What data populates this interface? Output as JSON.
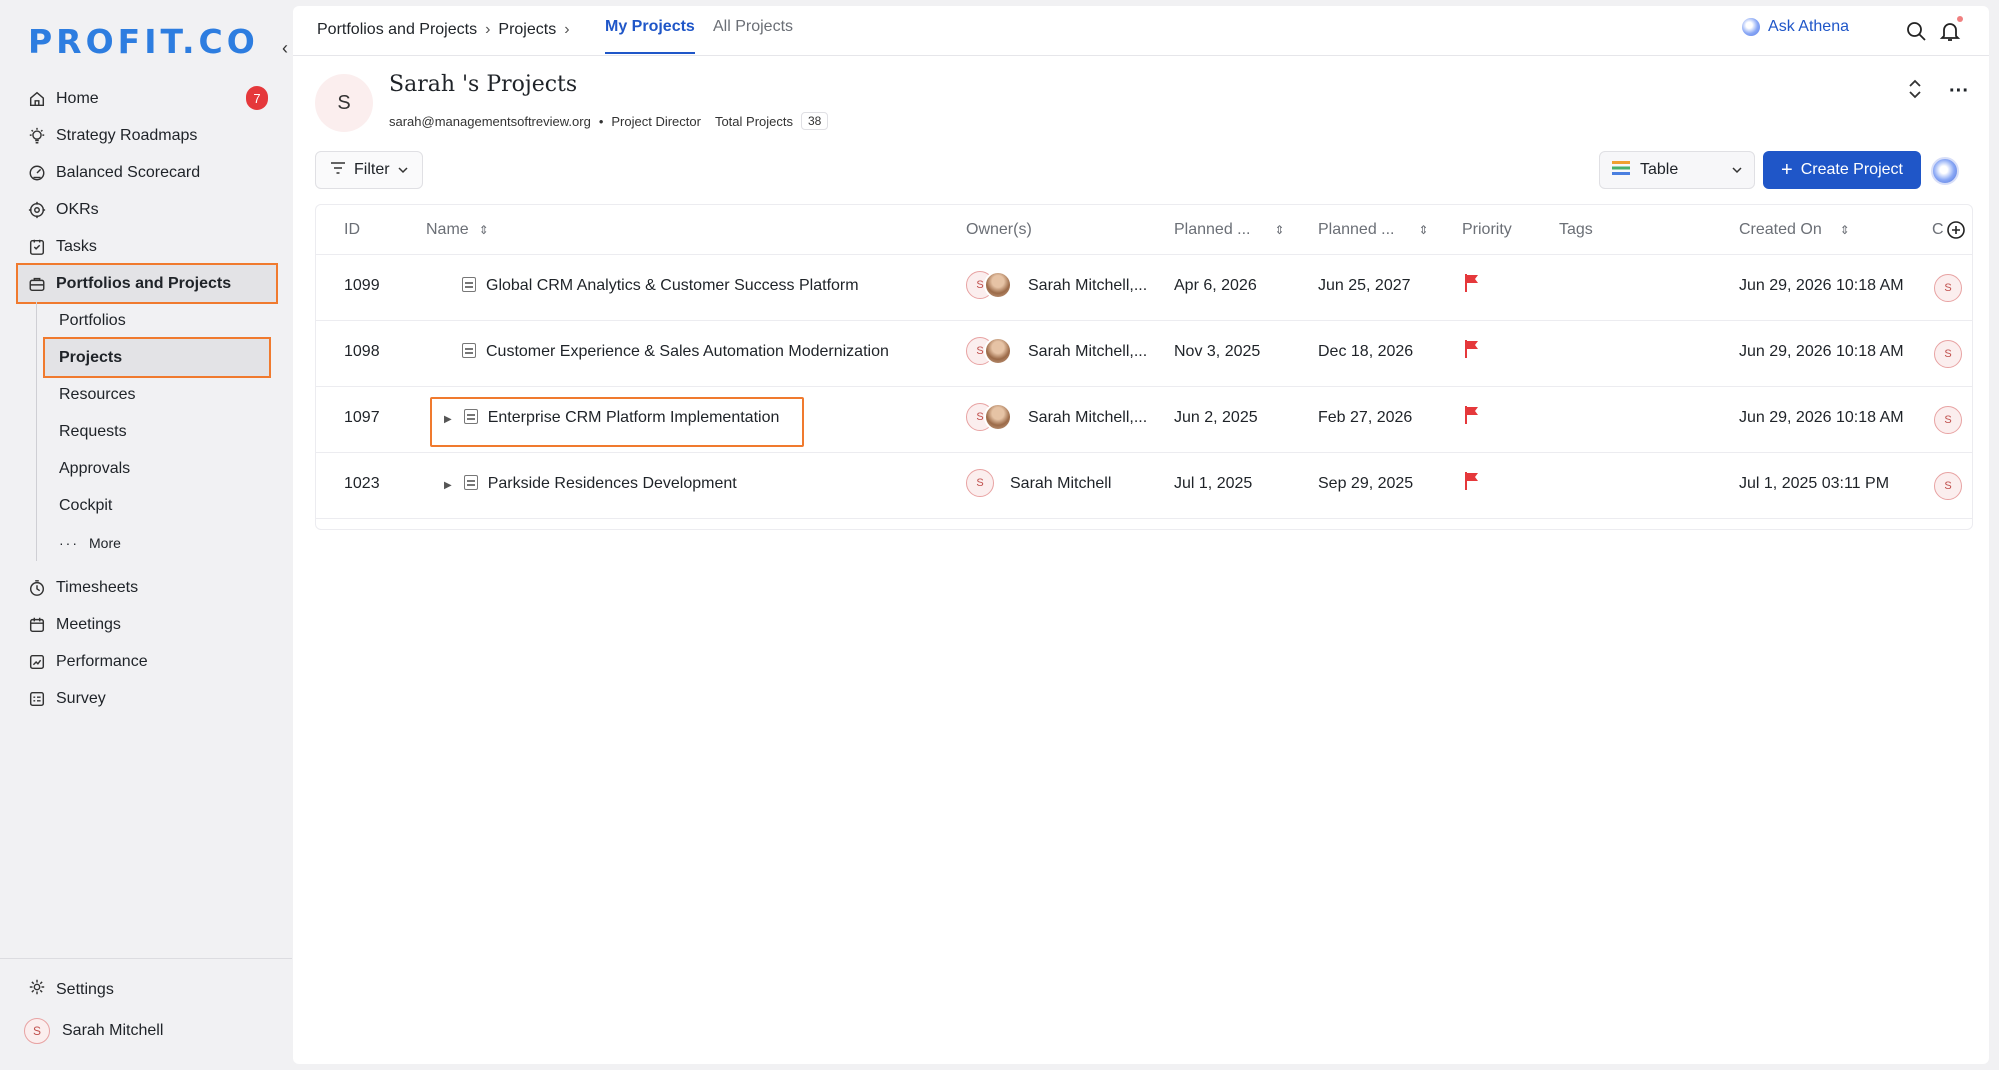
{
  "brand": {
    "logo_text": "PROFIT.CO"
  },
  "sidebar": {
    "collapse_glyph": "‹",
    "items": [
      {
        "label": "Home",
        "icon": "home-icon",
        "badge": "7"
      },
      {
        "label": "Strategy Roadmaps",
        "icon": "bulb-icon"
      },
      {
        "label": "Balanced Scorecard",
        "icon": "scorecard-icon"
      },
      {
        "label": "OKRs",
        "icon": "target-icon"
      },
      {
        "label": "Tasks",
        "icon": "tasks-icon"
      },
      {
        "label": "Portfolios and Projects",
        "icon": "briefcase-icon",
        "active": true
      }
    ],
    "subitems": [
      {
        "label": "Portfolios"
      },
      {
        "label": "Projects",
        "active": true
      },
      {
        "label": "Resources"
      },
      {
        "label": "Requests"
      },
      {
        "label": "Approvals"
      },
      {
        "label": "Cockpit"
      },
      {
        "label": "More"
      }
    ],
    "items2": [
      {
        "label": "Timesheets",
        "icon": "timer-icon"
      },
      {
        "label": "Meetings",
        "icon": "calendar-icon"
      },
      {
        "label": "Performance",
        "icon": "chart-icon"
      },
      {
        "label": "Survey",
        "icon": "survey-icon"
      }
    ],
    "settings_label": "Settings",
    "user": {
      "initial": "S",
      "name": "Sarah Mitchell"
    }
  },
  "topbar": {
    "breadcrumbs": [
      "Portfolios and Projects",
      "Projects"
    ],
    "crumb_sep": "›",
    "tabs": [
      {
        "label": "My Projects",
        "active": true
      },
      {
        "label": "All Projects"
      }
    ],
    "ask_label": "Ask Athena"
  },
  "header": {
    "avatar_initial": "S",
    "title": "Sarah 's Projects",
    "email": "sarah@managementsoftreview.org",
    "bullet": "•",
    "role": "Project Director",
    "total_label": "Total Projects",
    "total_count": "38",
    "more_glyph": "···"
  },
  "toolbar": {
    "filter_label": "Filter",
    "view_label": "Table",
    "create_label": "Create Project",
    "create_plus": "+"
  },
  "table": {
    "columns": [
      "ID",
      "Name",
      "Owner(s)",
      "Planned ...",
      "Planned ...",
      "Priority",
      "Tags",
      "Created On",
      "C"
    ],
    "rows": [
      {
        "id": "1099",
        "name": "Global CRM Analytics & Customer Success Platform",
        "owner": "Sarah Mitchell,...",
        "start": "Apr 6, 2026",
        "end": "Jun 25, 2027",
        "created": "Jun 29, 2026 10:18 AM",
        "expandable": false,
        "photo": true,
        "avatar": "S",
        "owner_initial": "S"
      },
      {
        "id": "1098",
        "name": "Customer Experience & Sales Automation Modernization",
        "owner": "Sarah Mitchell,...",
        "start": "Nov 3, 2025",
        "end": "Dec 18, 2026",
        "created": "Jun 29, 2026 10:18 AM",
        "expandable": false,
        "photo": true,
        "avatar": "S",
        "owner_initial": "S"
      },
      {
        "id": "1097",
        "name": "Enterprise CRM Platform Implementation",
        "owner": "Sarah Mitchell,...",
        "start": "Jun 2, 2025",
        "end": "Feb 27, 2026",
        "created": "Jun 29, 2026 10:18 AM",
        "expandable": true,
        "photo": true,
        "highlight": true,
        "avatar": "S",
        "owner_initial": "S"
      },
      {
        "id": "1023",
        "name": "Parkside Residences Development",
        "owner": "Sarah Mitchell",
        "start": "Jul 1, 2025",
        "end": "Sep 29, 2025",
        "created": "Jul 1, 2025 03:11 PM",
        "expandable": true,
        "photo": false,
        "avatar": "S",
        "owner_initial": "S"
      }
    ]
  },
  "colors": {
    "accent": "#1f56c8",
    "highlight": "#f07a2e",
    "flag": "#e5383b",
    "badge": "#e5383b"
  }
}
